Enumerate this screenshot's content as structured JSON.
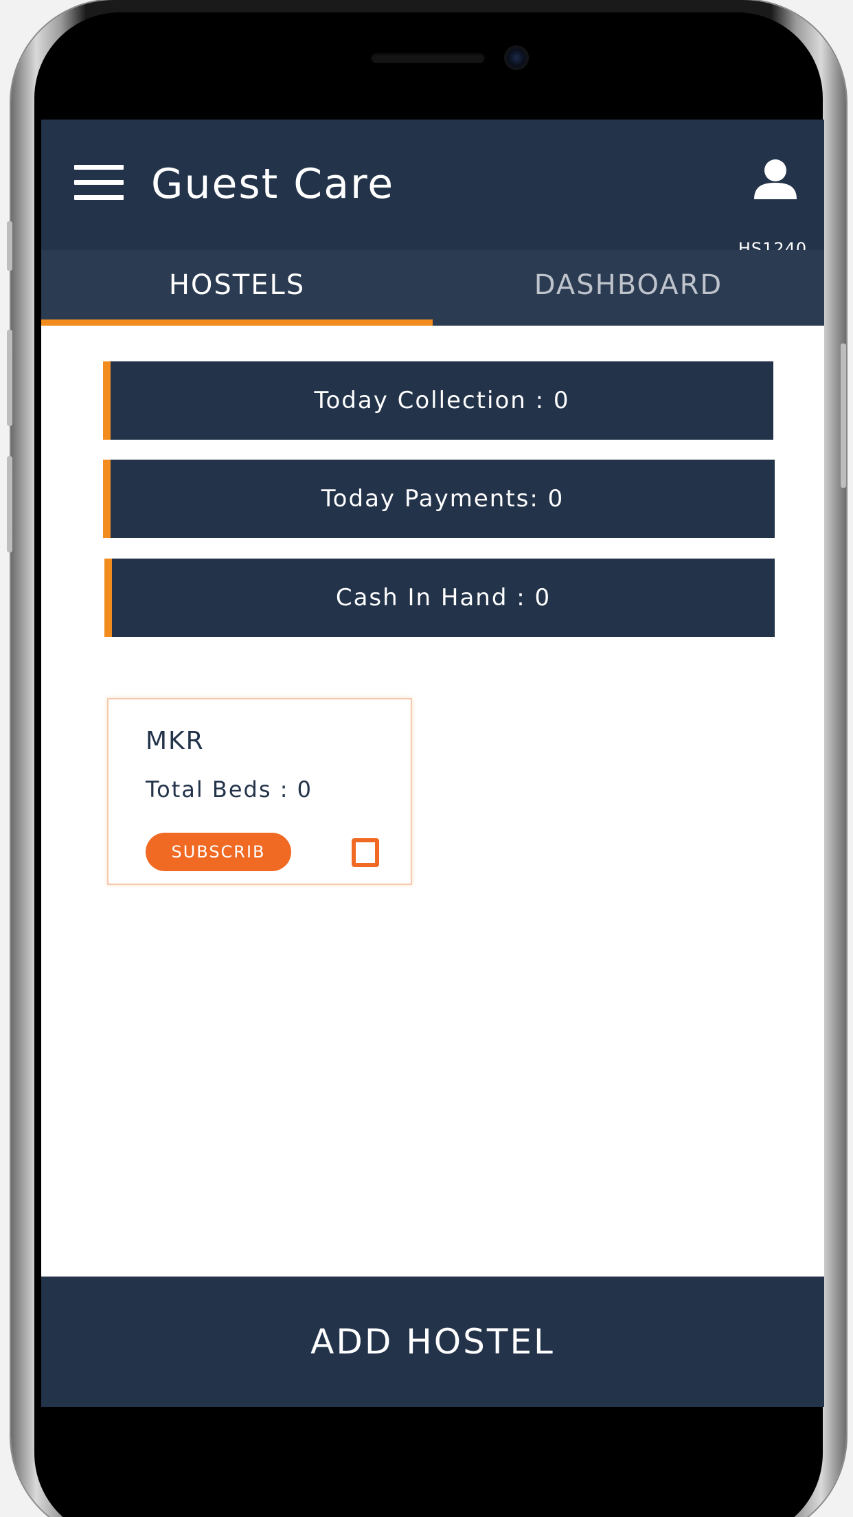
{
  "header": {
    "title": "Guest Care",
    "user_id": "HS1240"
  },
  "tabs": [
    {
      "label": "HOSTELS",
      "active": true
    },
    {
      "label": "DASHBOARD",
      "active": false
    }
  ],
  "stats": {
    "today_collection": "Today Collection  :  0",
    "today_payments": "Today Payments:  0",
    "cash_in_hand": "Cash In Hand  :  0"
  },
  "hostel_card": {
    "name": "MKR",
    "total_beds": "Total Beds  :  0",
    "subscribe_label": "SUBSCRIB"
  },
  "footer": {
    "add_hostel_label": "ADD HOSTEL"
  },
  "colors": {
    "navy": "#23334a",
    "accent_orange": "#f28c1e",
    "button_orange": "#f06a23"
  },
  "icons": [
    "menu-icon",
    "user-icon",
    "checkbox-icon"
  ]
}
